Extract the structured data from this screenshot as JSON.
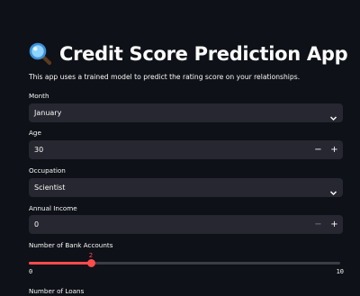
{
  "app": {
    "title": "Credit Score Prediction App",
    "title_icon": "magnifying-glass-icon",
    "description": "This app uses a trained model to predict the rating score on your relationships."
  },
  "form": {
    "month": {
      "label": "Month",
      "value": "January",
      "icon": "chevron-down-icon"
    },
    "age": {
      "label": "Age",
      "value": "30",
      "minus": "−",
      "plus": "+"
    },
    "occupation": {
      "label": "Occupation",
      "value": "Scientist",
      "icon": "chevron-down-icon"
    },
    "annual_income": {
      "label": "Annual Income",
      "value": "0",
      "minus": "−",
      "plus": "+"
    },
    "bank_accounts": {
      "label": "Number of Bank Accounts",
      "value": "2",
      "min": "0",
      "max": "10",
      "level": 0.2
    },
    "loans": {
      "label": "Number of Loans"
    }
  },
  "colors": {
    "background": "#0e1117",
    "field": "#262730",
    "accent": "#ff4b4b",
    "text": "#fafafa"
  }
}
